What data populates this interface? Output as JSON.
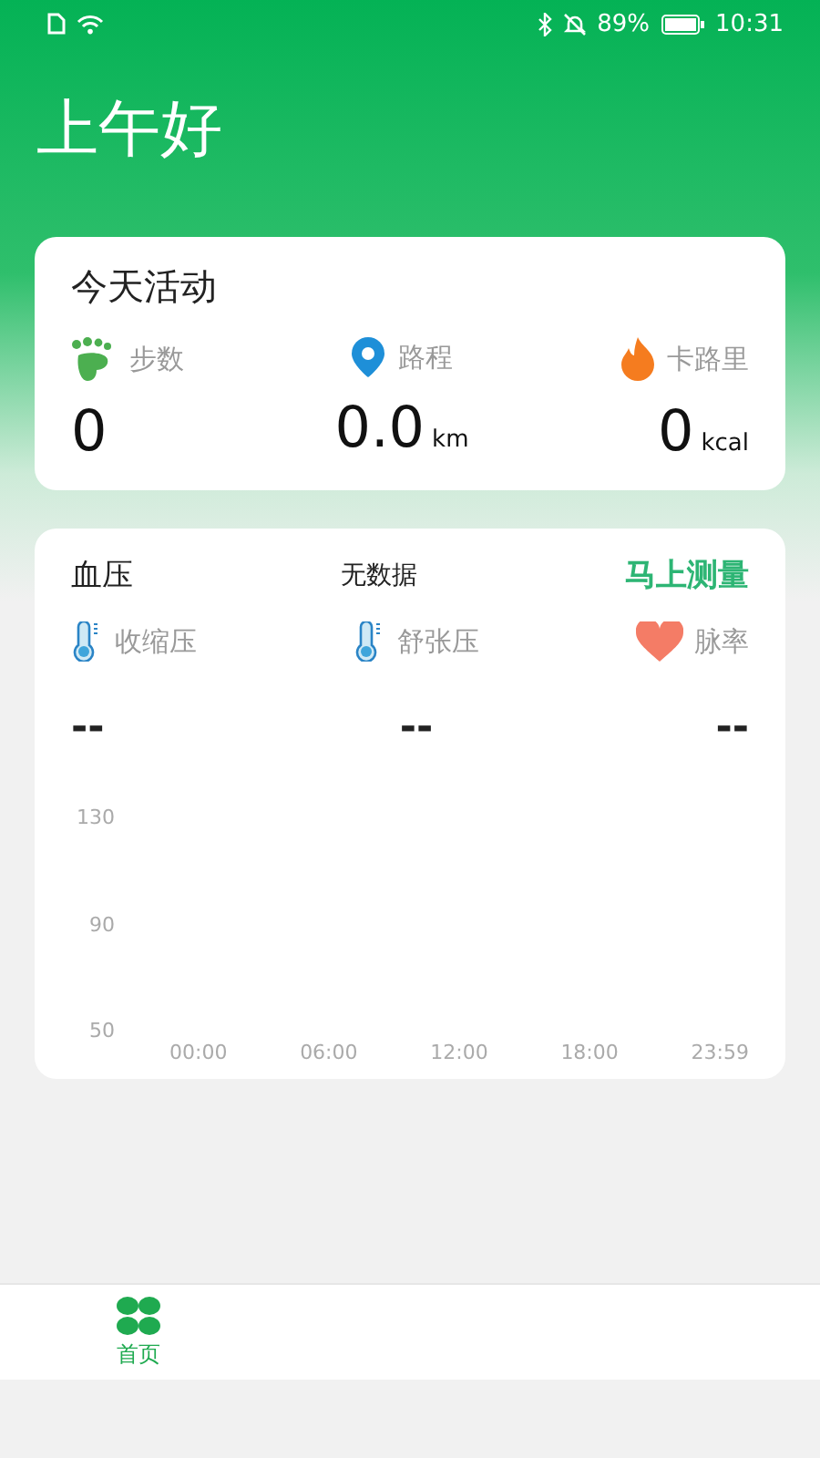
{
  "status_bar": {
    "battery": "89%",
    "time": "10:31"
  },
  "greeting": "上午好",
  "activity": {
    "title": "今天活动",
    "stats": [
      {
        "kind": "steps",
        "label": "步数",
        "value": "0"
      },
      {
        "kind": "distance",
        "label": "路程",
        "value": "0.0",
        "unit": "km"
      },
      {
        "kind": "calories",
        "label": "卡路里",
        "value": "0",
        "unit": "kcal"
      }
    ]
  },
  "blood_pressure": {
    "title": "血压",
    "status": "无数据",
    "action": "马上测量",
    "metrics": [
      {
        "kind": "thermometer",
        "label": "收缩压",
        "value": "--"
      },
      {
        "kind": "thermometer",
        "label": "舒张压",
        "value": "--"
      },
      {
        "kind": "heart",
        "label": "脉率",
        "value": "--"
      }
    ],
    "chart": {
      "y_labels": [
        "130",
        "90",
        "50"
      ],
      "x_labels": [
        "00:00",
        "06:00",
        "12:00",
        "18:00",
        "23:59"
      ]
    }
  },
  "nav": [
    {
      "label": "首页",
      "selected": true
    }
  ]
}
